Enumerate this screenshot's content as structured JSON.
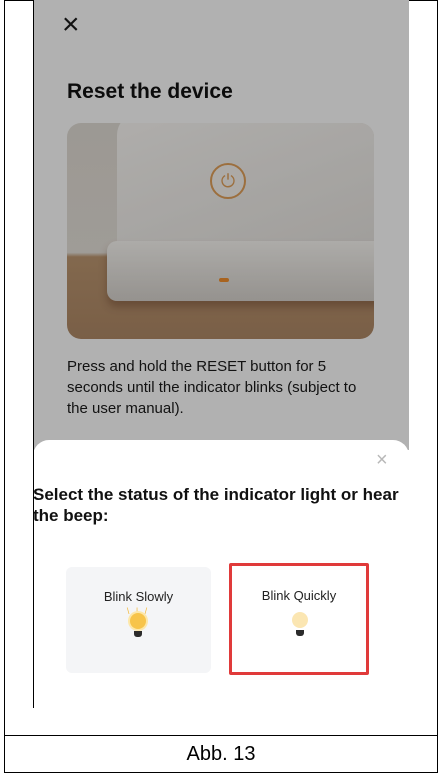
{
  "screen": {
    "close_glyph": "×",
    "title": "Reset the device",
    "description": "Press and hold the RESET button for 5 seconds until the indicator blinks (subject to the user manual)."
  },
  "sheet": {
    "close_glyph": "×",
    "prompt": "Select the status of the indicator light or hear the beep:",
    "options": [
      {
        "label": "Blink Slowly",
        "icon": "bright-bulb-icon",
        "selected": false
      },
      {
        "label": "Blink Quickly",
        "icon": "dim-bulb-icon",
        "selected": true
      }
    ]
  },
  "document": {
    "caption": "Abb. 13"
  },
  "colors": {
    "highlight": "#e03a3a",
    "bulb_bright": "#f7c44a",
    "bulb_dim": "#fbe6b2"
  }
}
